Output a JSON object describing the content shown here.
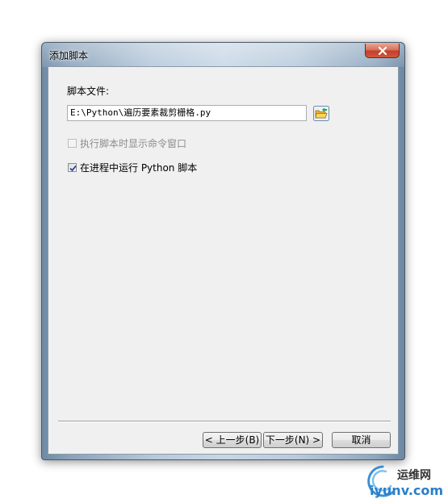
{
  "window": {
    "title": "添加脚本"
  },
  "form": {
    "script_file_label": "脚本文件:",
    "script_path_value": "E:\\Python\\遍历要素裁剪栅格.py",
    "show_cmd_label": "执行脚本时显示命令窗口",
    "show_cmd_checked": false,
    "show_cmd_enabled": false,
    "run_in_process_label": "在进程中运行 Python 脚本",
    "run_in_process_checked": true
  },
  "buttons": {
    "back_label": "< 上一步(B)",
    "next_label": "下一步(N) >",
    "cancel_label": "取消"
  },
  "watermark": {
    "site_name": "运维网",
    "domain": "iyunv.com"
  },
  "icons": {
    "close": "close-icon",
    "browse": "folder-open-icon",
    "check": "checkmark-icon"
  }
}
